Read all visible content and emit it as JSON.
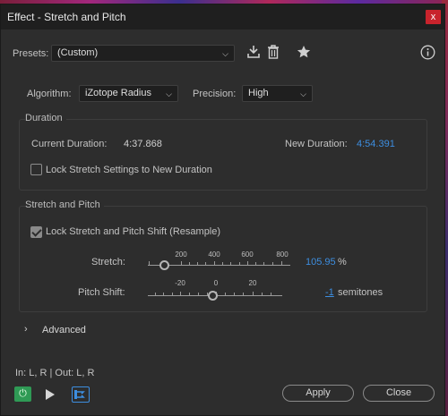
{
  "window": {
    "title": "Effect - Stretch and Pitch",
    "close_glyph": "x"
  },
  "presets": {
    "label": "Presets:",
    "value": "(Custom)"
  },
  "algorithm": {
    "label": "Algorithm:",
    "value": "iZotope Radius"
  },
  "precision": {
    "label": "Precision:",
    "value": "High"
  },
  "duration": {
    "title": "Duration",
    "current_label": "Current Duration:",
    "current_value": "4:37.868",
    "new_label": "New Duration:",
    "new_value": "4:54.391",
    "lock_label": "Lock Stretch Settings to New Duration",
    "lock_checked": false
  },
  "stretch_pitch": {
    "title": "Stretch and Pitch",
    "lock_label": "Lock Stretch and Pitch Shift (Resample)",
    "lock_checked": true,
    "stretch": {
      "label": "Stretch:",
      "value": "105.95",
      "unit": "%",
      "ticks": [
        "200",
        "400",
        "600",
        "800"
      ],
      "position": 105.95
    },
    "pitch": {
      "label": "Pitch Shift:",
      "value": "-1",
      "unit": "semitones",
      "ticks": [
        "-20",
        "0",
        "20"
      ],
      "position": -1
    }
  },
  "advanced": {
    "label": "Advanced"
  },
  "io": {
    "text": "In: L, R | Out: L, R"
  },
  "buttons": {
    "apply": "Apply",
    "close": "Close"
  },
  "colors": {
    "accent": "#3d8ee0",
    "power": "#2f9a55",
    "close": "#c8232c"
  },
  "icons": [
    "download-icon",
    "trash-icon",
    "star-icon",
    "info-icon",
    "power-icon",
    "play-icon",
    "route-icon",
    "chevron-right-icon"
  ]
}
